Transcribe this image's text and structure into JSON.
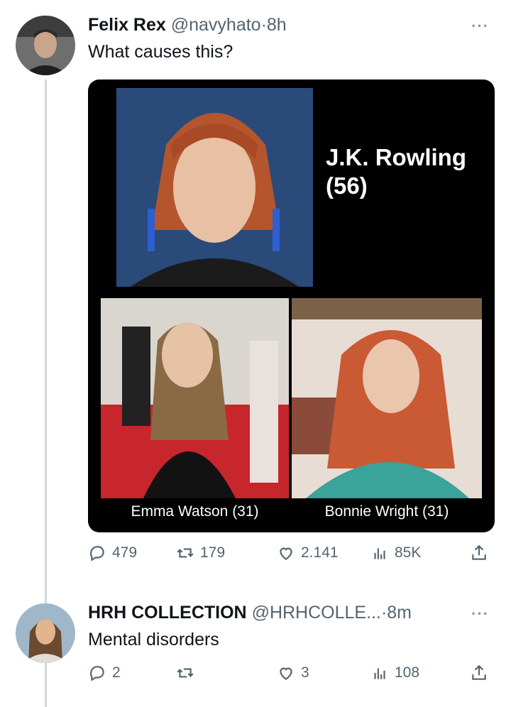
{
  "tweets": [
    {
      "name": "Felix Rex",
      "handle": "@navyhato",
      "sep": "·",
      "time": "8h",
      "more": "···",
      "text": "What causes this?",
      "media": {
        "main_caption_line1": "J.K. Rowling",
        "main_caption_line2": "(56)",
        "left_caption": "Emma Watson (31)",
        "right_caption": "Bonnie Wright (31)"
      },
      "stats": {
        "replies": "479",
        "retweets": "179",
        "likes": "2.141",
        "views": "85K"
      }
    },
    {
      "name": "HRH COLLECTION",
      "handle": "@HRHCOLLE...",
      "sep": "·",
      "time": "8m",
      "more": "···",
      "text": "Mental disorders",
      "stats": {
        "replies": "2",
        "retweets": "",
        "likes": "3",
        "views": "108"
      }
    }
  ],
  "icons": {
    "reply": "comment-bubble-icon",
    "retweet": "retweet-arrows-icon",
    "like": "heart-icon",
    "views": "bar-chart-icon",
    "share": "share-upload-icon"
  },
  "colors": {
    "text": "#0f1419",
    "secondary": "#536471",
    "thread": "#cfd9de"
  }
}
